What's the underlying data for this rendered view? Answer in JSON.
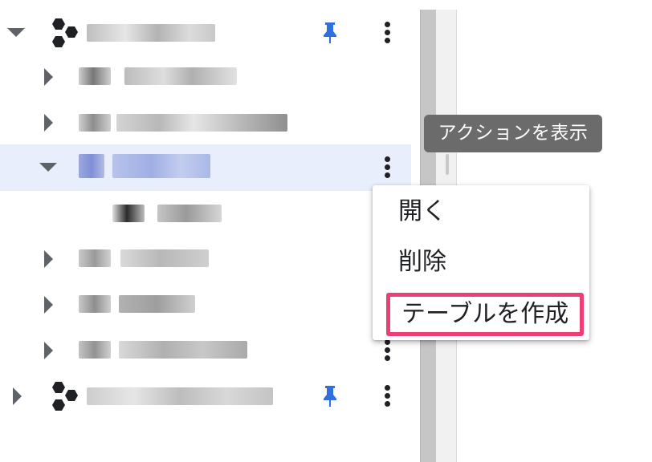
{
  "tooltip": {
    "text": "アクションを表示"
  },
  "context_menu": {
    "items": [
      {
        "label": "開く"
      },
      {
        "label": "削除"
      },
      {
        "label": "テーブルを作成"
      }
    ],
    "highlighted_index": 2
  },
  "colors": {
    "pin": "#2f6fde",
    "highlight_border": "#ee3f74",
    "selected_row_bg": "#e8eefb",
    "tooltip_bg": "#6b6b6b"
  },
  "icons": {
    "project": "hexagon-cluster-icon",
    "pin": "pin-icon",
    "more": "more-vert-icon",
    "expand": "chevron-down-icon",
    "collapse": "chevron-right-icon"
  }
}
